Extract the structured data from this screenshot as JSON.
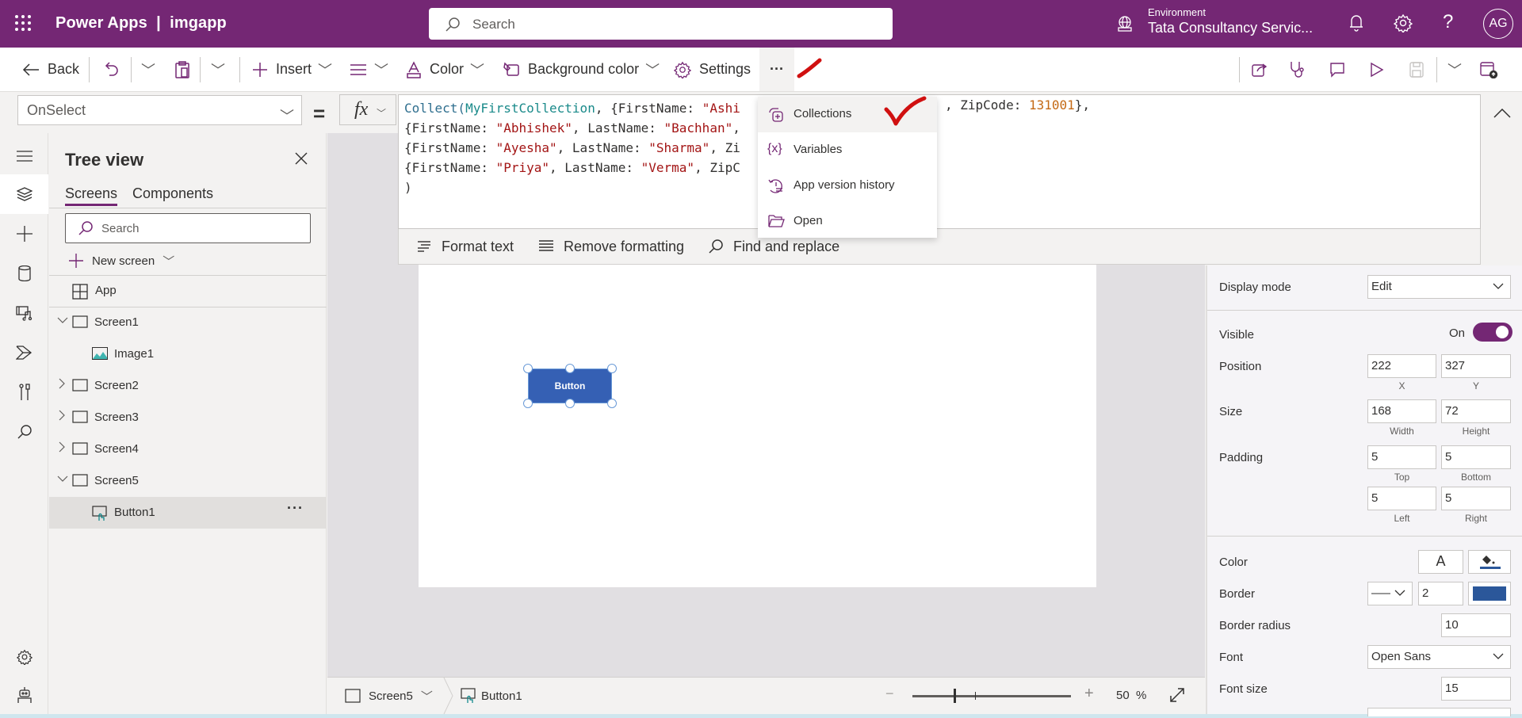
{
  "header": {
    "app_title": "Power Apps  |  imgapp",
    "search_placeholder": "Search",
    "environment_label": "Environment",
    "environment_name": "Tata Consultancy Servic...",
    "avatar_initials": "AG",
    "brand_color": "#742774"
  },
  "commandbar": {
    "back": "Back",
    "insert": "Insert",
    "color": "Color",
    "background_color": "Background color",
    "settings": "Settings",
    "more": "···"
  },
  "overflow_menu": {
    "items": [
      {
        "label": "Collections",
        "icon": "collections-icon"
      },
      {
        "label": "Variables",
        "icon": "variables-icon"
      },
      {
        "label": "App version history",
        "icon": "version-history-icon"
      },
      {
        "label": "Open",
        "icon": "open-folder-icon"
      }
    ]
  },
  "formula": {
    "property": "OnSelect",
    "equals": "=",
    "fx": "fx",
    "lines": [
      [
        {
          "t": "fn",
          "v": "Collect("
        },
        {
          "t": "id",
          "v": "MyFirstCollection"
        },
        {
          "t": "p",
          "v": ", {FirstName: "
        },
        {
          "t": "str",
          "v": "\"Ashi"
        }
      ],
      [
        {
          "t": "p",
          "v": "{FirstName: "
        },
        {
          "t": "str",
          "v": "\"Abhishek\""
        },
        {
          "t": "p",
          "v": ", LastName: "
        },
        {
          "t": "str",
          "v": "\"Bachhan\""
        },
        {
          "t": "p",
          "v": ","
        }
      ],
      [
        {
          "t": "p",
          "v": "{FirstName: "
        },
        {
          "t": "str",
          "v": "\"Ayesha\""
        },
        {
          "t": "p",
          "v": ", LastName: "
        },
        {
          "t": "str",
          "v": "\"Sharma\""
        },
        {
          "t": "p",
          "v": ", Zi"
        }
      ],
      [
        {
          "t": "p",
          "v": "{FirstName: "
        },
        {
          "t": "str",
          "v": "\"Priya\""
        },
        {
          "t": "p",
          "v": ", LastName: "
        },
        {
          "t": "str",
          "v": "\"Verma\""
        },
        {
          "t": "p",
          "v": ", ZipC"
        }
      ],
      [
        {
          "t": "p",
          "v": ")"
        }
      ]
    ],
    "line1_tail_pre": ", ZipCode: ",
    "line1_tail_num": "131001",
    "line1_tail_post": "},",
    "tools": {
      "format_text": "Format text",
      "remove_formatting": "Remove formatting",
      "find_replace": "Find and replace"
    }
  },
  "tree": {
    "title": "Tree view",
    "tabs": [
      "Screens",
      "Components"
    ],
    "search_placeholder": "Search",
    "new_screen": "New screen",
    "app_item": "App",
    "items": [
      {
        "label": "Screen1",
        "expanded": true,
        "level": 0,
        "type": "screen"
      },
      {
        "label": "Image1",
        "level": 1,
        "type": "image"
      },
      {
        "label": "Screen2",
        "expanded": false,
        "level": 0,
        "type": "screen"
      },
      {
        "label": "Screen3",
        "expanded": false,
        "level": 0,
        "type": "screen"
      },
      {
        "label": "Screen4",
        "expanded": false,
        "level": 0,
        "type": "screen"
      },
      {
        "label": "Screen5",
        "expanded": true,
        "level": 0,
        "type": "screen"
      },
      {
        "label": "Button1",
        "level": 1,
        "type": "button",
        "selected": true
      }
    ]
  },
  "canvas": {
    "button_text": "Button",
    "button_color": "#3560b4"
  },
  "statusbar": {
    "screen": "Screen5",
    "control": "Button1",
    "zoom_value": "50",
    "zoom_unit": "%"
  },
  "properties": {
    "display_mode_label": "Display mode",
    "display_mode_value": "Edit",
    "visible_label": "Visible",
    "visible_value": "On",
    "position_label": "Position",
    "position_x": "222",
    "position_y": "327",
    "x_label": "X",
    "y_label": "Y",
    "size_label": "Size",
    "width": "168",
    "height": "72",
    "width_label": "Width",
    "height_label": "Height",
    "padding_label": "Padding",
    "padding_top": "5",
    "padding_bottom": "5",
    "padding_left": "5",
    "padding_right": "5",
    "top_label": "Top",
    "bottom_label": "Bottom",
    "left_label": "Left",
    "right_label": "Right",
    "color_label": "Color",
    "color_text_glyph": "A",
    "border_label": "Border",
    "border_width": "2",
    "border_color": "#2b579a",
    "border_radius_label": "Border radius",
    "border_radius": "10",
    "font_label": "Font",
    "font_value": "Open Sans",
    "font_size_label": "Font size",
    "font_size": "15"
  }
}
